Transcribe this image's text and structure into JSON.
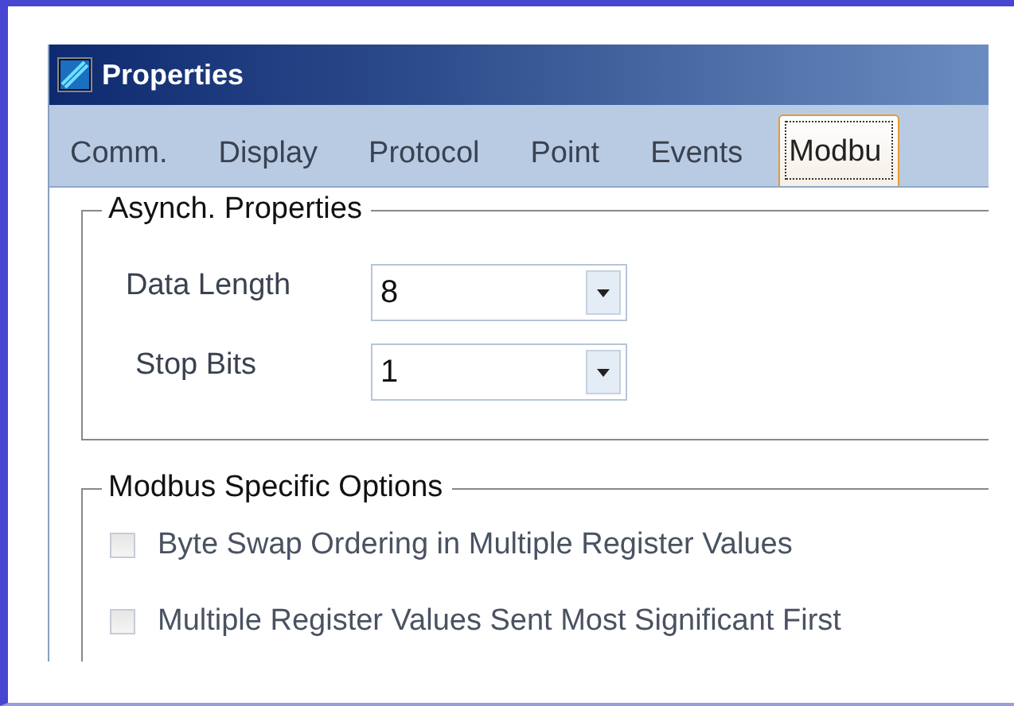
{
  "window": {
    "title": "Properties"
  },
  "tabs": [
    {
      "label": "Comm.",
      "selected": false
    },
    {
      "label": "Display",
      "selected": false
    },
    {
      "label": "Protocol",
      "selected": false
    },
    {
      "label": "Point",
      "selected": false
    },
    {
      "label": "Events",
      "selected": false
    },
    {
      "label": "Modbu",
      "selected": true
    }
  ],
  "groups": [
    {
      "title": "Asynch. Properties",
      "items": [
        {
          "kind": "combo",
          "label": "Data Length",
          "value": "8"
        },
        {
          "kind": "combo",
          "label": "Stop Bits",
          "value": "1"
        }
      ]
    },
    {
      "title": "Modbus Specific Options",
      "items": [
        {
          "kind": "checkbox",
          "label": "Byte Swap Ordering in Multiple Register Values",
          "checked": false,
          "disabled": true
        },
        {
          "kind": "checkbox",
          "label": "Multiple Register Values Sent Most Significant First",
          "checked": false,
          "disabled": true
        }
      ]
    }
  ]
}
